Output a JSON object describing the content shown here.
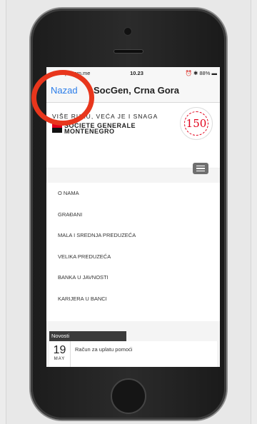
{
  "status_bar": {
    "carrier": "•••oo spotmm.me",
    "time": "10.23",
    "battery": "88%"
  },
  "nav": {
    "back_label": "Nazad",
    "title": "SocGen, Crna Gora"
  },
  "header": {
    "slogan": "VIŠE RUKU, VEĆA JE I SNAGA",
    "brand_line1": "SOCIETE GENERALE",
    "brand_line2": "MONTENEGRO",
    "badge_number": "150"
  },
  "menu": {
    "items": [
      {
        "label": "O NAMA"
      },
      {
        "label": "GRAĐANI"
      },
      {
        "label": "MALA I SREDNJA PREDUZEĆA"
      },
      {
        "label": "VELIKA PREDUZEĆA"
      },
      {
        "label": "BANKA U JAVNOSTI"
      },
      {
        "label": "KARIJERA U BANCI"
      }
    ]
  },
  "news": {
    "tab_label": "Novosti",
    "day": "19",
    "month": "MAY",
    "headline": "Račun za uplatu pomoći"
  },
  "colors": {
    "brand_red": "#e2001a",
    "link_blue": "#2b7de9",
    "annotation_circle": "#e8361c"
  }
}
